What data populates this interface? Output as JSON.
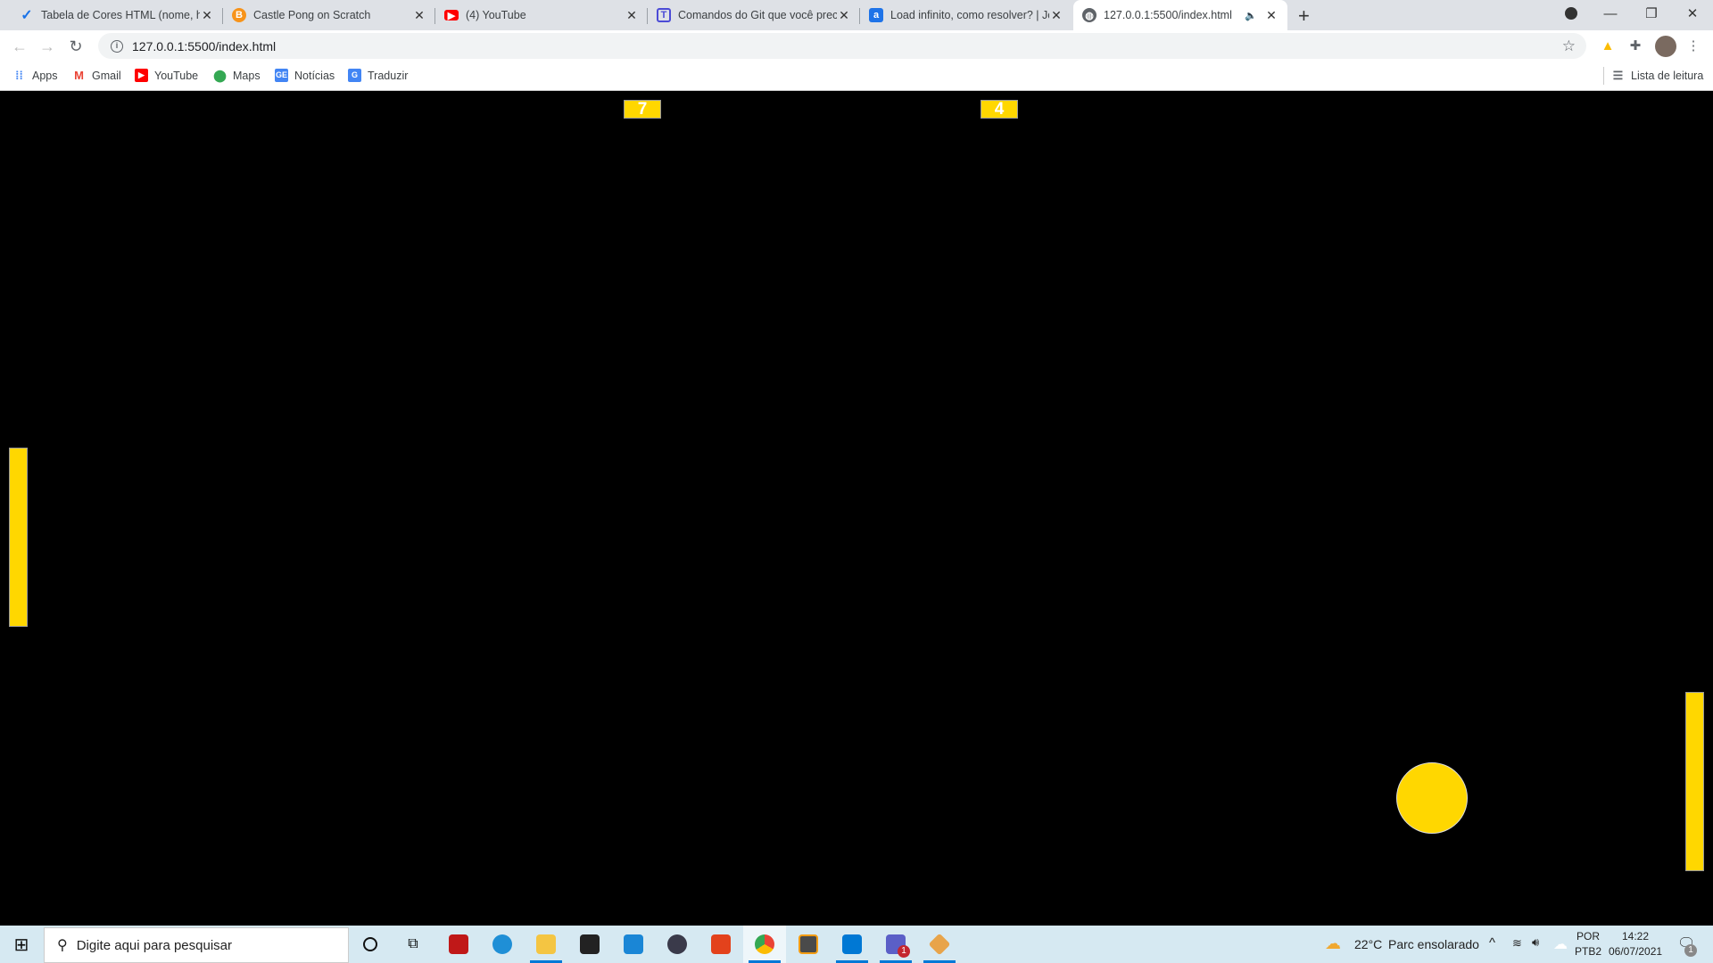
{
  "browser": {
    "tabs": [
      {
        "title": "Tabela de Cores HTML (nome, hex",
        "icon": "swoosh-icon",
        "color": "#1a73e8"
      },
      {
        "title": "Castle Pong on Scratch",
        "icon": "bitcoin-like-icon",
        "color": "#f7931a"
      },
      {
        "title": "(4) YouTube",
        "icon": "youtube-icon",
        "color": "#ff0000"
      },
      {
        "title": "Comandos do Git que você precisa",
        "icon": "t-icon",
        "color": "#4b4bd6"
      },
      {
        "title": "Load infinito, como resolver? | Jo",
        "icon": "alura-icon",
        "color": "#1e73e8"
      },
      {
        "title": "127.0.0.1:5500/index.html",
        "icon": "globe-icon",
        "color": "#5f6368",
        "active": true,
        "audio": true
      }
    ],
    "url": "127.0.0.1:5500/index.html",
    "bookmarks": [
      {
        "label": "Apps",
        "icon": "apps-grid-icon",
        "color": "#4285f4"
      },
      {
        "label": "Gmail",
        "icon": "gmail-icon",
        "color": "#ea4335"
      },
      {
        "label": "YouTube",
        "icon": "youtube-icon",
        "color": "#ff0000"
      },
      {
        "label": "Maps",
        "icon": "maps-pin-icon",
        "color": "#34a853"
      },
      {
        "label": "Notícias",
        "icon": "news-icon",
        "color": "#4285f4"
      },
      {
        "label": "Traduzir",
        "icon": "translate-icon",
        "color": "#4285f4"
      }
    ],
    "reading_list": "Lista de leitura"
  },
  "game": {
    "score_left": "7",
    "score_right": "4",
    "color": "#ffd700",
    "background": "#000000"
  },
  "taskbar": {
    "search_placeholder": "Digite aqui para pesquisar",
    "weather_temp": "22°C",
    "weather_text": "Parc ensolarado",
    "lang_top": "POR",
    "lang_bottom": "PTB2",
    "time": "14:22",
    "date": "06/07/2021",
    "notifications": "1",
    "teams_badge": "1"
  }
}
